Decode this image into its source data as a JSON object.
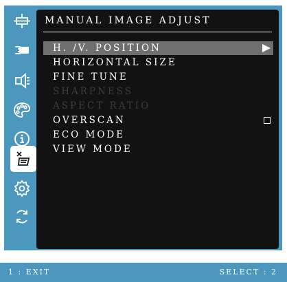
{
  "osd": {
    "title": "MANUAL IMAGE ADJUST",
    "sidebar": {
      "icons": [
        "display-position-icon",
        "input-source-icon",
        "audio-adjust-icon",
        "color-adjust-icon",
        "information-icon",
        "manual-image-adjust-icon",
        "setup-menu-icon",
        "memory-recall-icon"
      ],
      "active_index": 5
    },
    "menu": {
      "items": [
        {
          "label": "H. /V. POSITION",
          "state": "selected",
          "indicator": "submenu-arrow"
        },
        {
          "label": "HORIZONTAL  SIZE",
          "state": "normal"
        },
        {
          "label": "FINE  TUNE",
          "state": "normal"
        },
        {
          "label": "SHARPNESS",
          "state": "disabled"
        },
        {
          "label": "ASPECT  RATIO",
          "state": "disabled"
        },
        {
          "label": "OVERSCAN",
          "state": "normal",
          "indicator": "checkbox-unchecked"
        },
        {
          "label": "ECO  MODE",
          "state": "normal"
        },
        {
          "label": "VIEW  MODE",
          "state": "normal"
        }
      ]
    },
    "footer": {
      "exit_label": "1 : EXIT",
      "select_label": "SELECT : 2"
    }
  },
  "colors": {
    "frame": "#4b97bd",
    "panel": "#121212",
    "selected_row": "#6f6f6f",
    "disabled_text": "#3c3c3c",
    "text": "#ffffff"
  }
}
